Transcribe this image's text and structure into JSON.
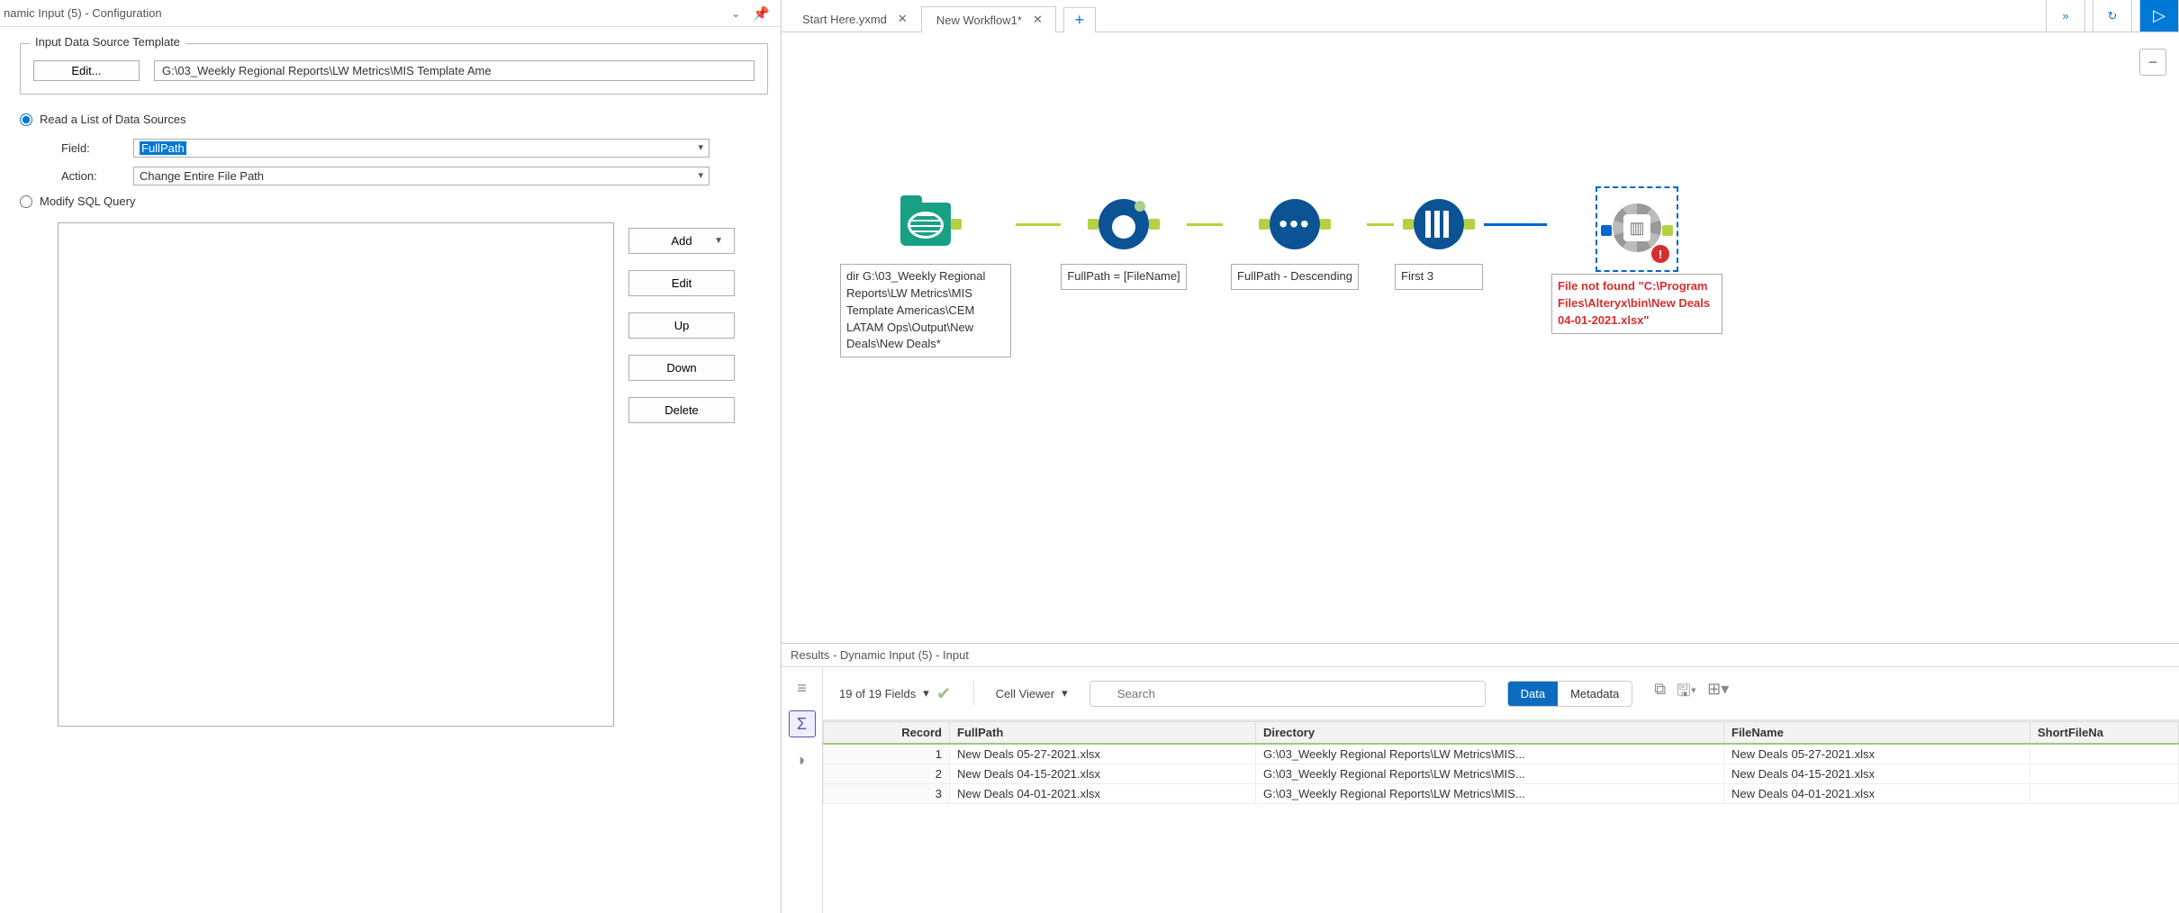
{
  "config": {
    "title": "namic Input (5) - Configuration",
    "fieldset_label": "Input Data Source Template",
    "edit_btn": "Edit...",
    "template_path": "G:\\03_Weekly Regional Reports\\LW Metrics\\MIS Template Ame",
    "radio_read_label": "Read a List of Data Sources",
    "field_label": "Field:",
    "field_value": "FullPath",
    "action_label": "Action:",
    "action_value": "Change Entire File Path",
    "radio_sql_label": "Modify SQL Query",
    "buttons": {
      "add": "Add",
      "edit": "Edit",
      "up": "Up",
      "down": "Down",
      "delete": "Delete"
    }
  },
  "tabs": [
    {
      "label": "Start Here.yxmd",
      "active": false
    },
    {
      "label": "New Workflow1*",
      "active": true
    }
  ],
  "nodes": {
    "dir": "dir G:\\03_Weekly Regional Reports\\LW Metrics\\MIS Template Americas\\CEM LATAM Ops\\Output\\New Deals\\New Deals*",
    "formula": "FullPath = [FileName]",
    "sort": "FullPath - Descending",
    "sample": "First 3",
    "error": "File not found \"C:\\Program Files\\Alteryx\\bin\\New Deals 04-01-2021.xlsx\""
  },
  "results": {
    "header": "Results - Dynamic Input (5) - Input",
    "fields_text": "19 of 19 Fields",
    "cellviewer": "Cell Viewer",
    "search_placeholder": "Search",
    "dm": {
      "data": "Data",
      "meta": "Metadata"
    },
    "columns": [
      "Record",
      "FullPath",
      "Directory",
      "FileName",
      "ShortFileNa"
    ],
    "rows": [
      {
        "rec": "1",
        "full": "New Deals 05-27-2021.xlsx",
        "dir": "G:\\03_Weekly Regional Reports\\LW Metrics\\MIS...",
        "fn": "New Deals 05-27-2021.xlsx"
      },
      {
        "rec": "2",
        "full": "New Deals 04-15-2021.xlsx",
        "dir": "G:\\03_Weekly Regional Reports\\LW Metrics\\MIS...",
        "fn": "New Deals 04-15-2021.xlsx"
      },
      {
        "rec": "3",
        "full": "New Deals 04-01-2021.xlsx",
        "dir": "G:\\03_Weekly Regional Reports\\LW Metrics\\MIS...",
        "fn": "New Deals 04-01-2021.xlsx"
      }
    ]
  }
}
